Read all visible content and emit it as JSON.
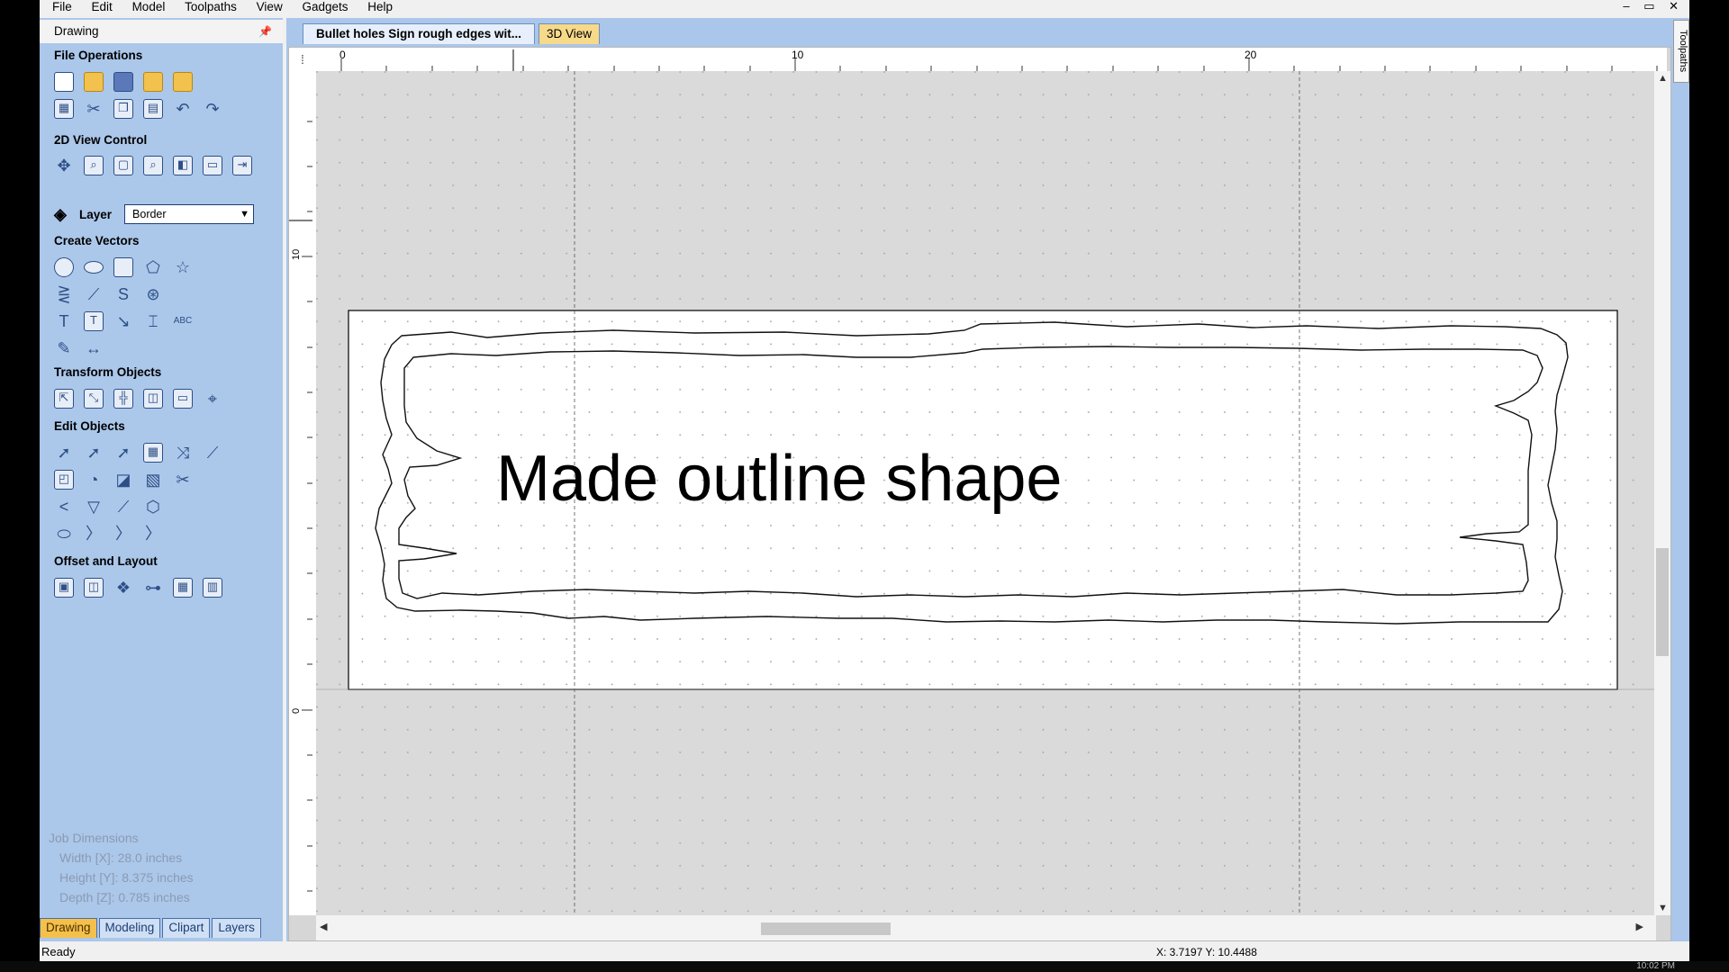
{
  "menu": [
    "File",
    "Edit",
    "Model",
    "Toolpaths",
    "View",
    "Gadgets",
    "Help"
  ],
  "window_controls": "– ▭ ✕",
  "sidebar": {
    "title": "Drawing",
    "sections": {
      "file_operations": "File Operations",
      "view_control": "2D View Control",
      "create_vectors": "Create Vectors",
      "transform_objects": "Transform Objects",
      "edit_objects": "Edit Objects",
      "offset_layout": "Offset and Layout"
    },
    "layer_label": "Layer",
    "layer_value": "Border",
    "job_dimensions": {
      "title": "Job Dimensions",
      "width": "Width  [X]: 28.0 inches",
      "height": "Height [Y]: 8.375 inches",
      "depth": "Depth  [Z]: 0.785 inches"
    },
    "bottom_tabs": [
      "Drawing",
      "Modeling",
      "Clipart",
      "Layers"
    ]
  },
  "doc_tabs": [
    "Bullet holes Sign rough edges wit...",
    "3D View"
  ],
  "ruler": {
    "h_labels": [
      "0",
      "10",
      "20"
    ],
    "v_labels": [
      "10",
      "0"
    ]
  },
  "canvas": {
    "text": "Made outline shape"
  },
  "status": {
    "ready": "Ready",
    "coords": "X: 3.7197 Y: 10.4488"
  },
  "side_tab": "Toolpaths",
  "clock": "10:02 PM"
}
